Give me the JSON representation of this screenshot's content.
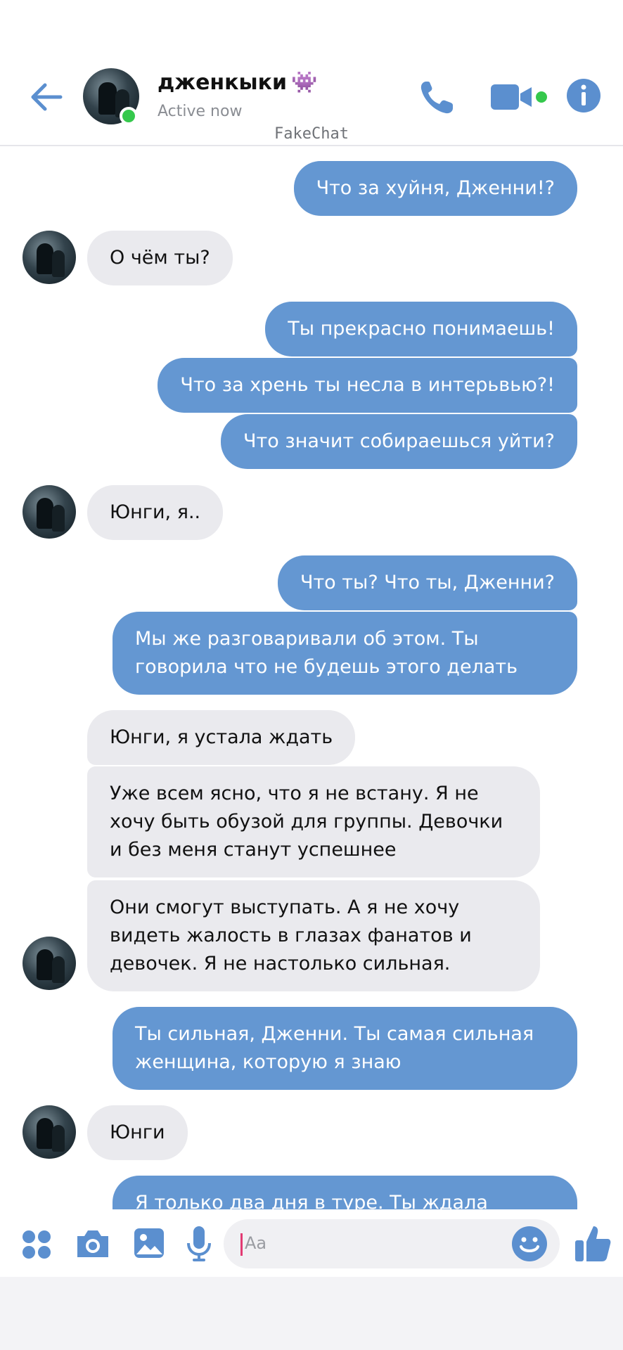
{
  "header": {
    "contact_name": "дженкыки",
    "contact_emoji": "👾",
    "status": "Active now",
    "watermark": "FakeChat"
  },
  "colors": {
    "accent": "#5b8fcf",
    "outgoing_bubble": "#6497d2",
    "incoming_bubble": "#eaeaee",
    "online": "#35c84c"
  },
  "icons": {
    "back": "arrow-left-icon",
    "call": "phone-icon",
    "video": "video-camera-icon",
    "info": "info-icon",
    "apps": "apps-grid-icon",
    "camera": "camera-icon",
    "gallery": "image-icon",
    "mic": "microphone-icon",
    "emoji": "smiley-icon",
    "like": "thumbs-up-icon"
  },
  "messages": [
    {
      "side": "out",
      "text": "Что за хуйня, Дженни!?"
    },
    {
      "side": "in",
      "text": "О чём ты?"
    },
    {
      "side": "out",
      "text": "Ты прекрасно понимаешь!"
    },
    {
      "side": "out",
      "text": "Что за хрень ты несла в интерьвью?!"
    },
    {
      "side": "out",
      "text": "Что значит собираешься уйти?"
    },
    {
      "side": "in",
      "text": "Юнги, я.."
    },
    {
      "side": "out",
      "text": "Что ты? Что ты, Дженни?"
    },
    {
      "side": "out",
      "text": "Мы же разговаривали об этом. Ты говорила что не будешь этого делать"
    },
    {
      "side": "in",
      "text": "Юнги, я устала ждать"
    },
    {
      "side": "in",
      "text": "Уже всем ясно, что я не встану. Я не хочу быть обузой для группы. Девочки и без меня станут успешнее"
    },
    {
      "side": "in",
      "text": "Они смогут выступать. А я не хочу видеть жалость в глазах фанатов и девочек. Я не настолько сильная."
    },
    {
      "side": "out",
      "text": "Ты сильная, Дженни. Ты самая сильная женщина, которую я знаю"
    },
    {
      "side": "in",
      "text": "Юнги"
    },
    {
      "side": "out",
      "text": "Я только два дня в туре. Ты ждала"
    }
  ],
  "composer": {
    "placeholder": "Aa"
  }
}
